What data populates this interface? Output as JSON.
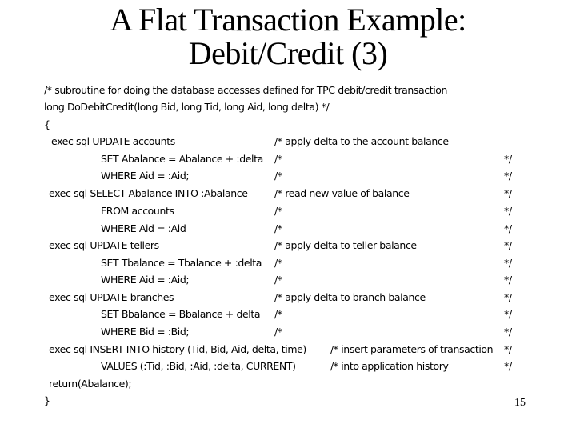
{
  "slide": {
    "title_line1": "A Flat Transaction Example:",
    "title_line2": "Debit/Credit (3)",
    "page_number": "15"
  },
  "code": {
    "header_comment": "/* subroutine for doing the database accesses defined for TPC debit/credit transaction",
    "signature": "long DoDebitCredit(long Bid, long Tid, long Aid, long delta) */",
    "open_brace": "{",
    "lines": [
      {
        "stmt": "exec sql UPDATE accounts",
        "comment": "/* apply delta to the account balance",
        "end": ""
      },
      {
        "stmt": "SET Abalance = Abalance + :delta",
        "comment": "/*",
        "end": "*/"
      },
      {
        "stmt": "WHERE Aid = :Aid;",
        "comment": "/*",
        "end": "*/"
      },
      {
        "stmt": "exec sql SELECT Abalance INTO :Abalance",
        "comment": "/* read new value of balance",
        "end": "*/"
      },
      {
        "stmt": "FROM accounts",
        "comment": "/*",
        "end": "*/"
      },
      {
        "stmt": "WHERE Aid = :Aid",
        "comment": "/*",
        "end": "*/"
      },
      {
        "stmt": "exec sql UPDATE tellers",
        "comment": "/* apply delta to teller balance",
        "end": "*/"
      },
      {
        "stmt": "SET Tbalance = Tbalance + :delta",
        "comment": "/*",
        "end": "*/"
      },
      {
        "stmt": "WHERE Aid = :Aid;",
        "comment": "/*",
        "end": "*/"
      },
      {
        "stmt": "exec sql UPDATE branches",
        "comment": "/* apply delta to branch balance",
        "end": "*/"
      },
      {
        "stmt": "SET Bbalance = Bbalance + delta",
        "comment": "/*",
        "end": "*/"
      },
      {
        "stmt": "WHERE Bid = :Bid;",
        "comment": "/*",
        "end": "*/"
      },
      {
        "stmt": "exec sql INSERT INTO history (Tid, Bid, Aid, delta, time)",
        "comment": "/* insert parameters of transaction",
        "end": "*/"
      },
      {
        "stmt": "VALUES (:Tid, :Bid, :Aid, :delta, CURRENT)",
        "comment": "/* into application history",
        "end": "*/"
      }
    ],
    "return_stmt": "return(Abalance);",
    "close_brace": "}"
  }
}
